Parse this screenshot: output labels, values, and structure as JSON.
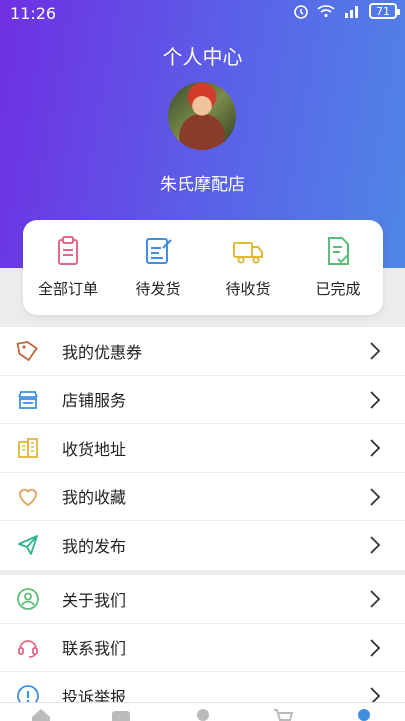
{
  "status_bar": {
    "time": "11:26",
    "battery": "71"
  },
  "header": {
    "title": "个人中心",
    "store_name": "朱氏摩配店"
  },
  "orders": [
    {
      "label": "全部订单",
      "icon": "clipboard-icon"
    },
    {
      "label": "待发货",
      "icon": "edit-document-icon"
    },
    {
      "label": "待收货",
      "icon": "truck-icon"
    },
    {
      "label": "已完成",
      "icon": "checked-document-icon"
    }
  ],
  "menu_group_1": [
    {
      "label": "我的优惠券",
      "icon": "tag-icon"
    },
    {
      "label": "店铺服务",
      "icon": "storefront-icon"
    },
    {
      "label": "收货地址",
      "icon": "building-icon"
    },
    {
      "label": "我的收藏",
      "icon": "heart-icon"
    },
    {
      "label": "我的发布",
      "icon": "send-icon"
    }
  ],
  "menu_group_2": [
    {
      "label": "关于我们",
      "icon": "user-circle-icon"
    },
    {
      "label": "联系我们",
      "icon": "headset-icon"
    },
    {
      "label": "投诉举报",
      "icon": "info-icon"
    }
  ],
  "colors": {
    "header_start": "#6f2fe2",
    "header_end": "#4f86e6",
    "order_pink": "#e06a86",
    "order_blue": "#3f8fe0",
    "order_yellow": "#e2b83a",
    "order_green": "#5bbf7a"
  }
}
